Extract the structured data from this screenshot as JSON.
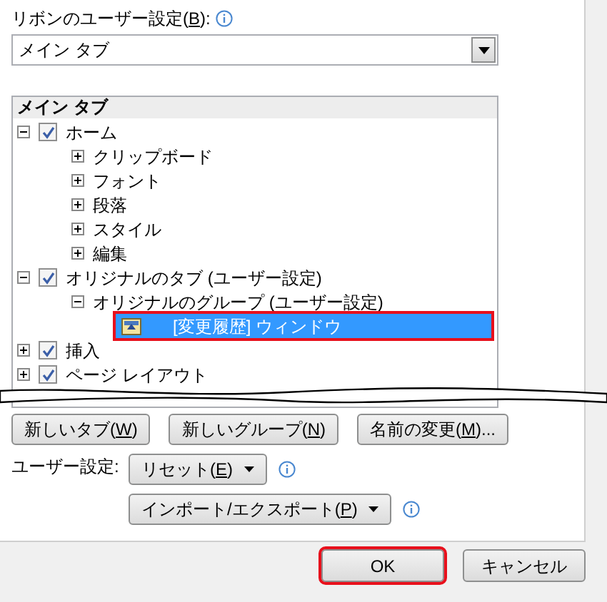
{
  "ribbon_setting": {
    "label": {
      "before": "リボンのユーザー設定(",
      "key": "B",
      "after": "):"
    },
    "value": "メイン タブ"
  },
  "tree": {
    "header": "メイン タブ",
    "items": [
      {
        "label": "ホーム",
        "checked": true,
        "expanded": true,
        "children": [
          {
            "label": "クリップボード",
            "expanded": false
          },
          {
            "label": "フォント",
            "expanded": false
          },
          {
            "label": "段落",
            "expanded": false
          },
          {
            "label": "スタイル",
            "expanded": false
          },
          {
            "label": "編集",
            "expanded": false
          }
        ]
      },
      {
        "label": "オリジナルのタブ (ユーザー設定)",
        "checked": true,
        "expanded": true,
        "children": [
          {
            "label": "オリジナルのグループ (ユーザー設定)",
            "expanded": true,
            "children": [
              {
                "label": "[変更履歴] ウィンドウ",
                "kind": "command",
                "selected": true
              }
            ]
          }
        ]
      },
      {
        "label": "挿入",
        "checked": true,
        "expanded": false
      },
      {
        "label": "ページ レイアウト",
        "checked": true,
        "expanded": false
      }
    ]
  },
  "tree_buttons": [
    {
      "before": "新しいタブ(",
      "key": "W",
      "after": ")"
    },
    {
      "before": "新しいグループ(",
      "key": "N",
      "after": ")"
    },
    {
      "before": "名前の変更(",
      "key": "M",
      "after": ")..."
    }
  ],
  "user_settings": {
    "label": "ユーザー設定:",
    "menus": [
      {
        "before": "リセット(",
        "key": "E",
        "after": ")"
      },
      {
        "before": "インポート/エクスポート(",
        "key": "P",
        "after": ")"
      }
    ]
  },
  "dialog_buttons": [
    {
      "label": "OK",
      "highlighted": true
    },
    {
      "label": "キャンセル",
      "highlighted": false
    }
  ]
}
